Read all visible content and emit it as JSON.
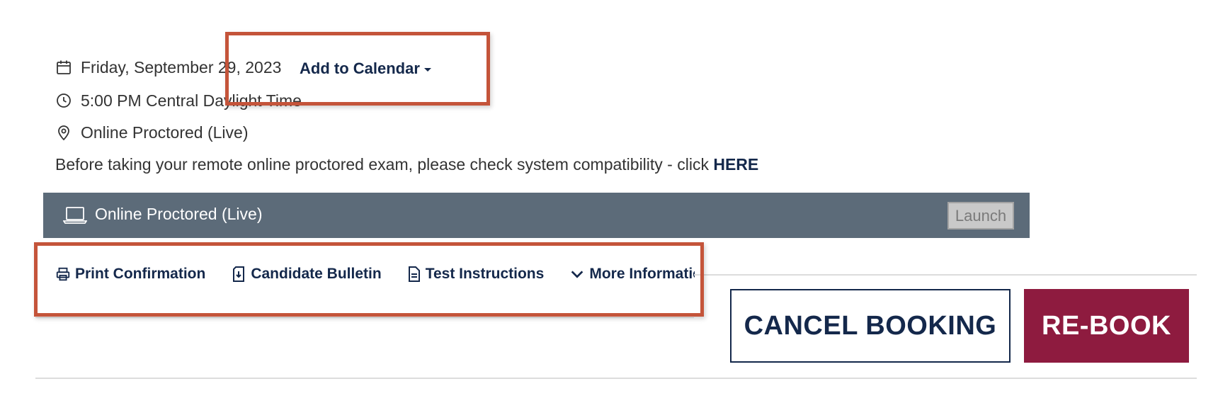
{
  "event": {
    "date": "Friday, September 29, 2023",
    "time": "5:00 PM Central Daylight Time",
    "location": "Online Proctored (Live)",
    "add_to_calendar": "Add to Calendar"
  },
  "compatibility": {
    "text": "Before taking your remote online proctored exam, please check system compatibility - click ",
    "link": "HERE"
  },
  "session_bar": {
    "label": "Online Proctored (Live)",
    "launch": "Launch"
  },
  "links": {
    "print": "Print Confirmation",
    "bulletin": "Candidate Bulletin",
    "instructions": "Test Instructions",
    "more": "More Information"
  },
  "actions": {
    "cancel": "CANCEL BOOKING",
    "rebook": "RE-BOOK"
  },
  "icons": {
    "date": "calendar-icon",
    "time": "clock-icon",
    "location": "location-pin-icon",
    "session": "laptop-icon",
    "print": "printer-icon",
    "bulletin": "document-download-icon",
    "instructions": "document-icon",
    "more": "chevron-down-icon"
  },
  "colors": {
    "navy": "#14284b",
    "bar": "#5c6b79",
    "rebook": "#8e1b3f",
    "highlight": "#c4543a"
  }
}
